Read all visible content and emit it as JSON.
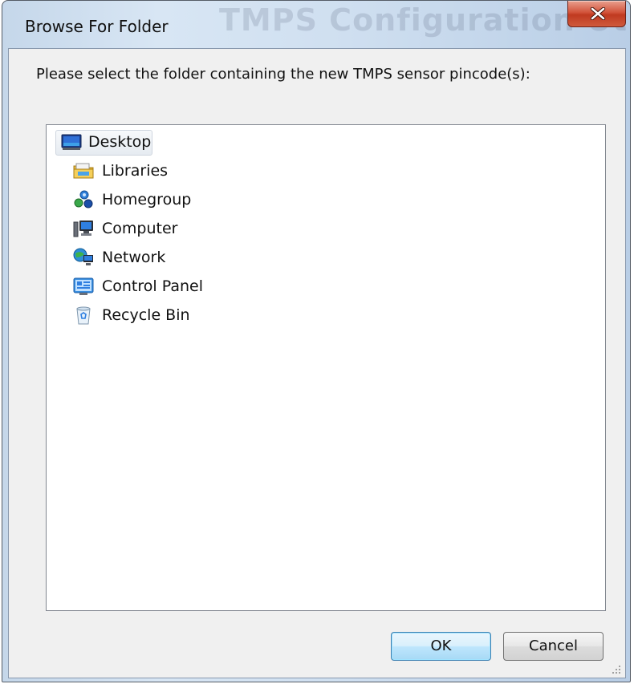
{
  "window": {
    "title": "Browse For Folder",
    "background_title": "TMPS Configuration Utility"
  },
  "dialog": {
    "instruction": "Please select the folder containing the new TMPS sensor pincode(s):"
  },
  "tree": {
    "items": [
      {
        "label": "Desktop",
        "icon": "desktop-icon",
        "expandable": false,
        "selected": true
      },
      {
        "label": "Libraries",
        "icon": "libraries-icon",
        "expandable": true
      },
      {
        "label": "Homegroup",
        "icon": "homegroup-icon",
        "expandable": true
      },
      {
        "label": "Computer",
        "icon": "computer-icon",
        "expandable": true
      },
      {
        "label": "Network",
        "icon": "network-icon",
        "expandable": true
      },
      {
        "label": "Control Panel",
        "icon": "control-panel-icon",
        "expandable": true
      },
      {
        "label": "Recycle Bin",
        "icon": "recycle-bin-icon",
        "expandable": false
      }
    ]
  },
  "buttons": {
    "ok": "OK",
    "cancel": "Cancel"
  },
  "colors": {
    "close_button": "#c9452b",
    "selection": "#e6ebf1",
    "ok_button": "#bee6fd"
  }
}
